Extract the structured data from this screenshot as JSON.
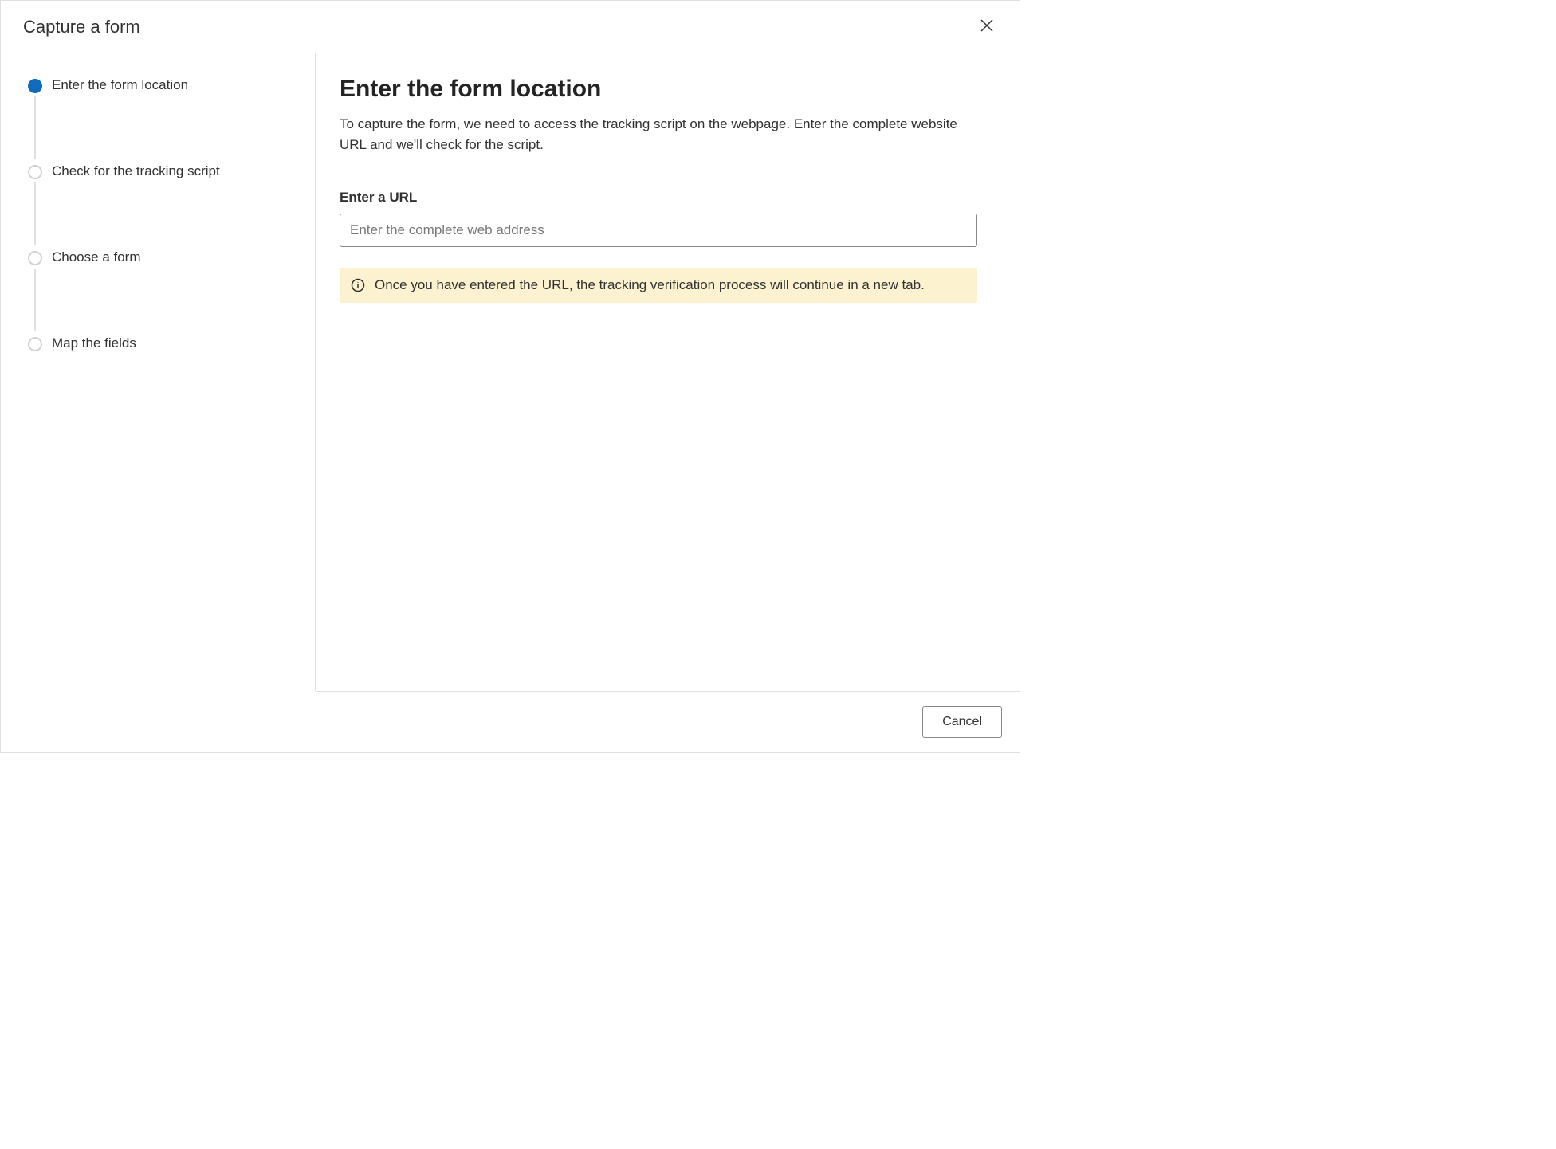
{
  "header": {
    "title": "Capture a form"
  },
  "sidebar": {
    "steps": [
      {
        "label": "Enter the form location",
        "active": true
      },
      {
        "label": "Check for the tracking script",
        "active": false
      },
      {
        "label": "Choose a form",
        "active": false
      },
      {
        "label": "Map the fields",
        "active": false
      }
    ]
  },
  "main": {
    "title": "Enter the form location",
    "description": "To capture the form, we need to access the tracking script on the webpage. Enter the complete website URL and we'll check for the script.",
    "url_field": {
      "label": "Enter a URL",
      "placeholder": "Enter the complete web address",
      "value": ""
    },
    "info_banner": {
      "text": "Once you have entered the URL, the tracking verification process will continue in a new tab."
    }
  },
  "footer": {
    "cancel_label": "Cancel"
  }
}
